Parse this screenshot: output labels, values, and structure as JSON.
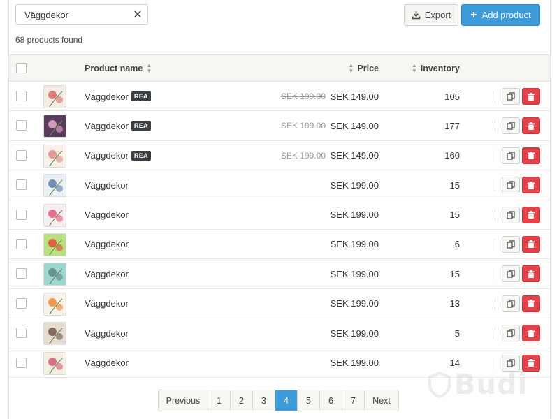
{
  "search": {
    "value": "Väggdekor"
  },
  "toolbar": {
    "export_label": "Export",
    "add_label": "Add product"
  },
  "results": {
    "count_text": "68 products found"
  },
  "table": {
    "headers": {
      "name": "Product name",
      "price": "Price",
      "inventory": "Inventory"
    },
    "rows": [
      {
        "name": "Väggdekor",
        "badge": "REA",
        "old_price": "SEK 199.00",
        "price": "SEK 149.00",
        "inventory": "105",
        "thumb": [
          "#f3ede6",
          "#d86a6a"
        ]
      },
      {
        "name": "Väggdekor",
        "badge": "REA",
        "old_price": "SEK 199.00",
        "price": "SEK 149.00",
        "inventory": "177",
        "thumb": [
          "#5a3c5e",
          "#e6a9c9"
        ]
      },
      {
        "name": "Väggdekor",
        "badge": "REA",
        "old_price": "SEK 199.00",
        "price": "SEK 149.00",
        "inventory": "160",
        "thumb": [
          "#f7f1ea",
          "#e08a8a"
        ]
      },
      {
        "name": "Väggdekor",
        "badge": "",
        "old_price": "",
        "price": "SEK 199.00",
        "inventory": "15",
        "thumb": [
          "#eaf0f6",
          "#5c7fa6"
        ]
      },
      {
        "name": "Väggdekor",
        "badge": "",
        "old_price": "",
        "price": "SEK 199.00",
        "inventory": "15",
        "thumb": [
          "#f6eef0",
          "#e25a7a"
        ]
      },
      {
        "name": "Väggdekor",
        "badge": "",
        "old_price": "",
        "price": "SEK 199.00",
        "inventory": "6",
        "thumb": [
          "#b8e07e",
          "#e64a3c"
        ]
      },
      {
        "name": "Väggdekor",
        "badge": "",
        "old_price": "",
        "price": "SEK 199.00",
        "inventory": "15",
        "thumb": [
          "#9ed6d0",
          "#5a8a86"
        ]
      },
      {
        "name": "Väggdekor",
        "badge": "",
        "old_price": "",
        "price": "SEK 199.00",
        "inventory": "13",
        "thumb": [
          "#f6f1ea",
          "#f08a2c"
        ]
      },
      {
        "name": "Väggdekor",
        "badge": "",
        "old_price": "",
        "price": "SEK 199.00",
        "inventory": "5",
        "thumb": [
          "#e6dcd2",
          "#6e5a4c"
        ]
      },
      {
        "name": "Väggdekor",
        "badge": "",
        "old_price": "",
        "price": "SEK 199.00",
        "inventory": "14",
        "thumb": [
          "#f3f0e2",
          "#d45a78"
        ]
      }
    ]
  },
  "pagination": {
    "previous": "Previous",
    "next": "Next",
    "pages": [
      "1",
      "2",
      "3",
      "4",
      "5",
      "6",
      "7"
    ],
    "active": "4"
  },
  "watermark": {
    "text": "Budi"
  },
  "colors": {
    "primary": "#3d9bd9",
    "danger": "#e0434a",
    "badge": "#3a3f44"
  },
  "icons": {
    "clear": "close-icon",
    "export": "download-icon",
    "add": "plus-icon",
    "sort": "sort-icon",
    "copy": "copy-icon",
    "delete": "trash-icon"
  }
}
